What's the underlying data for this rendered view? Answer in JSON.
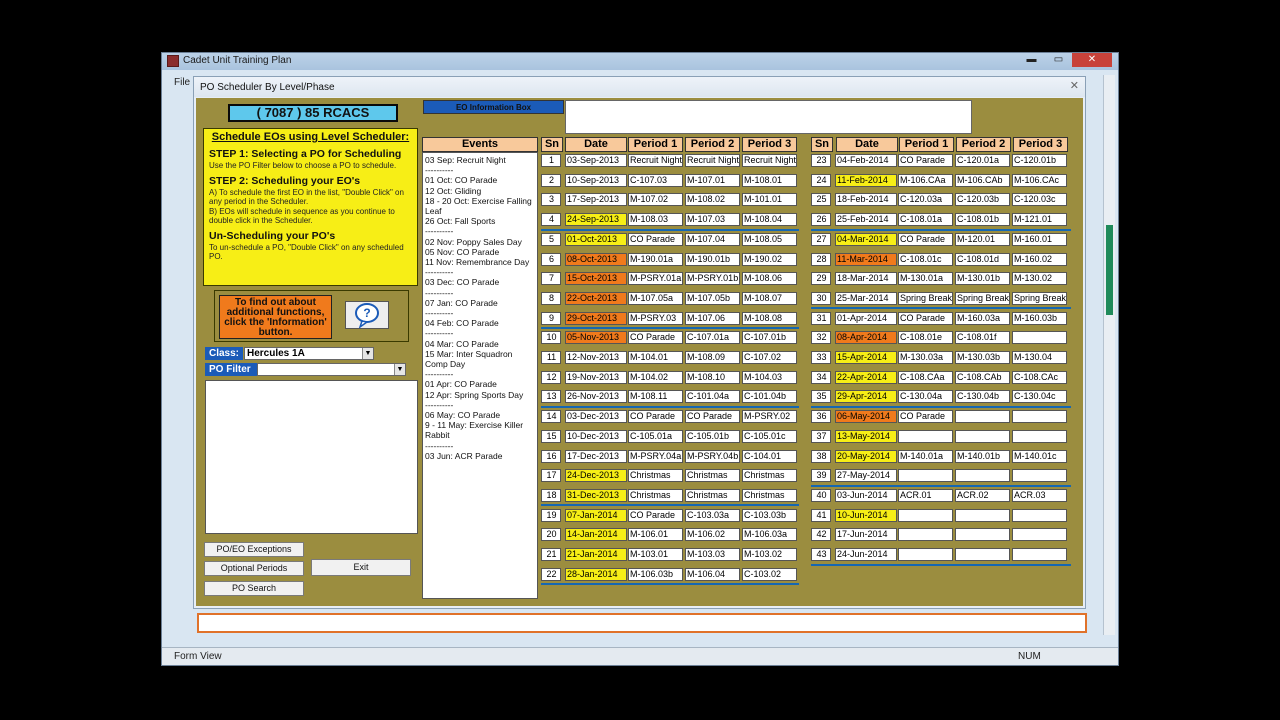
{
  "app_title": "Cadet Unit Training Plan",
  "menu_partial": "File",
  "form_title": "PO Scheduler By Level/Phase",
  "status": {
    "left": "Form View",
    "right": "NUM"
  },
  "unit_name": "( 7087 ) 85 RCACS",
  "instructions": {
    "heading": "Schedule EOs using Level Scheduler:",
    "step1_title": "STEP 1: Selecting a PO for Scheduling",
    "step1_text": "Use the PO Filter below to choose a PO to schedule.",
    "step2_title": "STEP 2: Scheduling your EO's",
    "step2_text_a": "A)  To schedule the first EO in the list, \"Double Click\" on any period in the Scheduler.",
    "step2_text_b": "B)  EOs will schedule in sequence as you continue to double click in the Scheduler.",
    "unsched_title": "Un-Scheduling your PO's",
    "unsched_text": "To un-schedule a PO, \"Double Click\" on any scheduled PO."
  },
  "info_text": "To find out about additional functions, click the 'Information' button.",
  "class_label": "Class:",
  "class_value": "Hercules 1A",
  "po_filter_label": "PO Filter",
  "buttons": {
    "exceptions": "PO/EO Exceptions",
    "optional": "Optional Periods",
    "search": "PO Search",
    "exit": "Exit"
  },
  "eo_info_label": "EO Information Box",
  "events_header": "Events",
  "events": [
    "03 Sep: Recruit Night",
    "----------",
    "01 Oct: CO Parade",
    "12 Oct: Gliding",
    "18 - 20 Oct: Exercise Falling Leaf",
    "26 Oct: Fall Sports",
    "----------",
    "02 Nov: Poppy Sales Day",
    "05 Nov: CO Parade",
    "11 Nov: Remembrance Day",
    "----------",
    "03 Dec: CO Parade",
    "----------",
    "07 Jan: CO Parade",
    "----------",
    "04 Feb: CO Parade",
    "----------",
    "04 Mar: CO Parade",
    "15 Mar: Inter Squadron Comp Day",
    "----------",
    "01 Apr: CO Parade",
    "12 Apr: Spring Sports Day",
    "----------",
    "06 May: CO Parade",
    "9 - 11 May: Exercise Killer Rabbit",
    "----------",
    "03 Jun: ACR Parade"
  ],
  "headers": {
    "sn": "Sn",
    "date": "Date",
    "p1": "Period 1",
    "p2": "Period 2",
    "p3": "Period 3"
  },
  "colors": {
    "yellow": "#f7ee16",
    "orange": "#f07a1c",
    "white": "#ffffff",
    "background": "#9b8d3f"
  },
  "schedule_left": [
    {
      "sn": "1",
      "date": "03-Sep-2013",
      "c": "white",
      "p": [
        "Recruit Night",
        "Recruit Night",
        "Recruit Night"
      ]
    },
    {
      "sn": "2",
      "date": "10-Sep-2013",
      "c": "white",
      "p": [
        "C-107.03",
        "M-107.01",
        "M-108.01"
      ]
    },
    {
      "sn": "3",
      "date": "17-Sep-2013",
      "c": "white",
      "p": [
        "M-107.02",
        "M-108.02",
        "M-101.01"
      ]
    },
    {
      "sn": "4",
      "date": "24-Sep-2013",
      "c": "yellow",
      "p": [
        "M-108.03",
        "M-107.03",
        "M-108.04"
      ]
    },
    {
      "sn": "5",
      "date": "01-Oct-2013",
      "c": "yellow",
      "p": [
        "CO Parade",
        "M-107.04",
        "M-108.05"
      ]
    },
    {
      "sn": "6",
      "date": "08-Oct-2013",
      "c": "orange",
      "p": [
        "M-190.01a",
        "M-190.01b",
        "M-190.02"
      ]
    },
    {
      "sn": "7",
      "date": "15-Oct-2013",
      "c": "orange",
      "p": [
        "M-PSRY.01a",
        "M-PSRY.01b",
        "M-108.06"
      ]
    },
    {
      "sn": "8",
      "date": "22-Oct-2013",
      "c": "orange",
      "p": [
        "M-107.05a",
        "M-107.05b",
        "M-108.07"
      ]
    },
    {
      "sn": "9",
      "date": "29-Oct-2013",
      "c": "orange",
      "p": [
        "M-PSRY.03",
        "M-107.06",
        "M-108.08"
      ]
    },
    {
      "sn": "10",
      "date": "05-Nov-2013",
      "c": "orange",
      "p": [
        "CO Parade",
        "C-107.01a",
        "C-107.01b"
      ]
    },
    {
      "sn": "11",
      "date": "12-Nov-2013",
      "c": "white",
      "p": [
        "M-104.01",
        "M-108.09",
        "C-107.02"
      ]
    },
    {
      "sn": "12",
      "date": "19-Nov-2013",
      "c": "white",
      "p": [
        "M-104.02",
        "M-108.10",
        "M-104.03"
      ]
    },
    {
      "sn": "13",
      "date": "26-Nov-2013",
      "c": "white",
      "p": [
        "M-108.11",
        "C-101.04a",
        "C-101.04b"
      ]
    },
    {
      "sn": "14",
      "date": "03-Dec-2013",
      "c": "white",
      "p": [
        "CO Parade",
        "CO Parade",
        "M-PSRY.02"
      ]
    },
    {
      "sn": "15",
      "date": "10-Dec-2013",
      "c": "white",
      "p": [
        "C-105.01a",
        "C-105.01b",
        "C-105.01c"
      ]
    },
    {
      "sn": "16",
      "date": "17-Dec-2013",
      "c": "white",
      "p": [
        "M-PSRY.04a",
        "M-PSRY.04b",
        "C-104.01"
      ]
    },
    {
      "sn": "17",
      "date": "24-Dec-2013",
      "c": "yellow",
      "p": [
        "Christmas",
        "Christmas",
        "Christmas"
      ]
    },
    {
      "sn": "18",
      "date": "31-Dec-2013",
      "c": "yellow",
      "p": [
        "Christmas",
        "Christmas",
        "Christmas"
      ]
    },
    {
      "sn": "19",
      "date": "07-Jan-2014",
      "c": "yellow",
      "p": [
        "CO Parade",
        "C-103.03a",
        "C-103.03b"
      ]
    },
    {
      "sn": "20",
      "date": "14-Jan-2014",
      "c": "yellow",
      "p": [
        "M-106.01",
        "M-106.02",
        "M-106.03a"
      ]
    },
    {
      "sn": "21",
      "date": "21-Jan-2014",
      "c": "yellow",
      "p": [
        "M-103.01",
        "M-103.03",
        "M-103.02"
      ]
    },
    {
      "sn": "22",
      "date": "28-Jan-2014",
      "c": "yellow",
      "p": [
        "M-106.03b",
        "M-106.04",
        "C-103.02"
      ]
    }
  ],
  "schedule_right": [
    {
      "sn": "23",
      "date": "04-Feb-2014",
      "c": "white",
      "p": [
        "CO Parade",
        "C-120.01a",
        "C-120.01b"
      ]
    },
    {
      "sn": "24",
      "date": "11-Feb-2014",
      "c": "yellow",
      "p": [
        "M-106.CAa",
        "M-106.CAb",
        "M-106.CAc"
      ]
    },
    {
      "sn": "25",
      "date": "18-Feb-2014",
      "c": "white",
      "p": [
        "C-120.03a",
        "C-120.03b",
        "C-120.03c"
      ]
    },
    {
      "sn": "26",
      "date": "25-Feb-2014",
      "c": "white",
      "p": [
        "C-108.01a",
        "C-108.01b",
        "M-121.01"
      ]
    },
    {
      "sn": "27",
      "date": "04-Mar-2014",
      "c": "yellow",
      "p": [
        "CO Parade",
        "M-120.01",
        "M-160.01"
      ]
    },
    {
      "sn": "28",
      "date": "11-Mar-2014",
      "c": "orange",
      "p": [
        "C-108.01c",
        "C-108.01d",
        "M-160.02"
      ]
    },
    {
      "sn": "29",
      "date": "18-Mar-2014",
      "c": "white",
      "p": [
        "M-130.01a",
        "M-130.01b",
        "M-130.02"
      ]
    },
    {
      "sn": "30",
      "date": "25-Mar-2014",
      "c": "white",
      "p": [
        "Spring Break",
        "Spring Break",
        "Spring Break"
      ]
    },
    {
      "sn": "31",
      "date": "01-Apr-2014",
      "c": "white",
      "p": [
        "CO Parade",
        "M-160.03a",
        "M-160.03b"
      ]
    },
    {
      "sn": "32",
      "date": "08-Apr-2014",
      "c": "orange",
      "p": [
        "C-108.01e",
        "C-108.01f",
        ""
      ]
    },
    {
      "sn": "33",
      "date": "15-Apr-2014",
      "c": "yellow",
      "p": [
        "M-130.03a",
        "M-130.03b",
        "M-130.04"
      ]
    },
    {
      "sn": "34",
      "date": "22-Apr-2014",
      "c": "yellow",
      "p": [
        "C-108.CAa",
        "C-108.CAb",
        "C-108.CAc"
      ]
    },
    {
      "sn": "35",
      "date": "29-Apr-2014",
      "c": "yellow",
      "p": [
        "C-130.04a",
        "C-130.04b",
        "C-130.04c"
      ]
    },
    {
      "sn": "36",
      "date": "06-May-2014",
      "c": "orange",
      "p": [
        "CO Parade",
        "",
        ""
      ]
    },
    {
      "sn": "37",
      "date": "13-May-2014",
      "c": "yellow",
      "p": [
        "",
        "",
        ""
      ]
    },
    {
      "sn": "38",
      "date": "20-May-2014",
      "c": "yellow",
      "p": [
        "M-140.01a",
        "M-140.01b",
        "M-140.01c"
      ]
    },
    {
      "sn": "39",
      "date": "27-May-2014",
      "c": "white",
      "p": [
        "",
        "",
        ""
      ]
    },
    {
      "sn": "40",
      "date": "03-Jun-2014",
      "c": "white",
      "p": [
        "ACR.01",
        "ACR.02",
        "ACR.03"
      ]
    },
    {
      "sn": "41",
      "date": "10-Jun-2014",
      "c": "yellow",
      "p": [
        "",
        "",
        ""
      ]
    },
    {
      "sn": "42",
      "date": "17-Jun-2014",
      "c": "white",
      "p": [
        "",
        "",
        ""
      ]
    },
    {
      "sn": "43",
      "date": "24-Jun-2014",
      "c": "white",
      "p": [
        "",
        "",
        ""
      ]
    }
  ]
}
